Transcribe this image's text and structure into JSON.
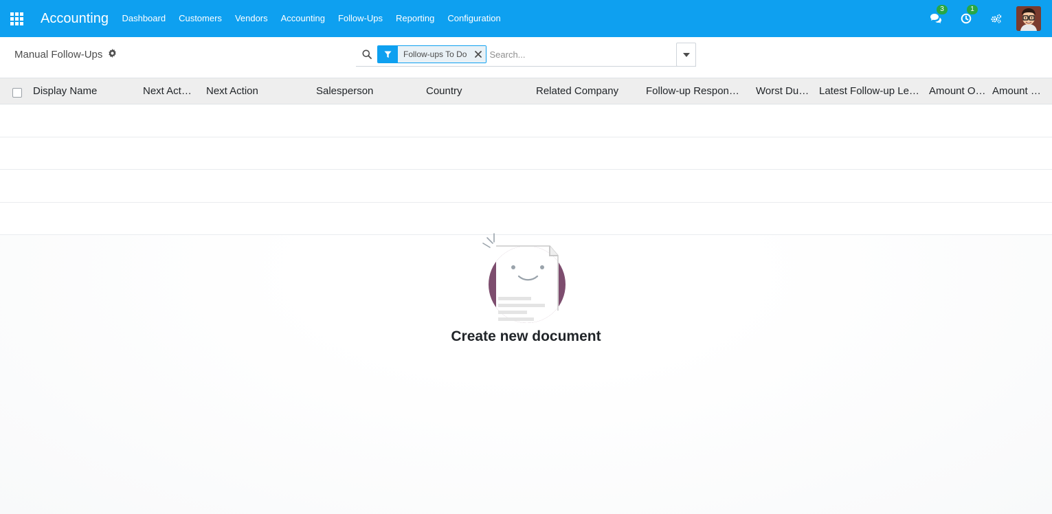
{
  "navbar": {
    "app_name": "Accounting",
    "menu": [
      "Dashboard",
      "Customers",
      "Vendors",
      "Accounting",
      "Follow-Ups",
      "Reporting",
      "Configuration"
    ],
    "messages_count": "3",
    "activities_count": "1",
    "bg_color": "#0ea0f0"
  },
  "breadcrumb": {
    "title": "Manual Follow-Ups"
  },
  "search": {
    "facet_label": "Follow-ups To Do",
    "placeholder": "Search..."
  },
  "table": {
    "columns": [
      "Display Name",
      "Next Act…",
      "Next Action",
      "Salesperson",
      "Country",
      "Related Company",
      "Follow-up Respon…",
      "Worst Due…",
      "Latest Follow-up Le…",
      "Amount O…",
      "Amount …"
    ]
  },
  "empty_state": {
    "title": "Create new document"
  },
  "icons": [
    "apps-grid-icon",
    "search-icon",
    "filter-icon",
    "close-icon",
    "caret-down-icon",
    "chat-icon",
    "clock-icon",
    "settings-icon",
    "gear-icon"
  ]
}
